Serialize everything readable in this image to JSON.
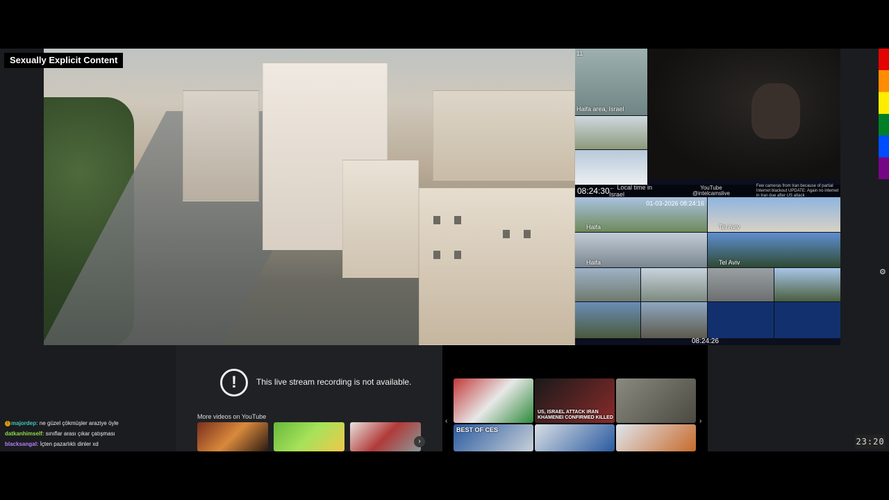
{
  "overlay": {
    "explicit_label": "Sexually Explicit Content"
  },
  "camera_grid": {
    "left_cam_a_number": "11",
    "left_cam_a_label": "Haifa area, Israel",
    "ticker_time": "08:24:30",
    "ticker_local": "← Local time in Israel",
    "ticker_source": "YouTube",
    "ticker_handle": "@intelcamslive",
    "ticker_news": "Few cameras from Iran because of partial Internet blackout UPDATE: Again no internet in Iran due after US attack",
    "tiles": [
      {
        "city": "Haifa",
        "timestamp": "01-03-2026 08:24:16"
      },
      {
        "city": "Tel Aviv",
        "timestamp": ""
      },
      {
        "city": "Haifa",
        "timestamp": ""
      },
      {
        "city": "Tel Aviv",
        "timestamp": ""
      }
    ],
    "bottom_clock": "08:24:26"
  },
  "youtube_embed": {
    "unavailable_message": "This live stream recording is not available.",
    "more_videos_label": "More videos on YouTube",
    "next_arrow": "›"
  },
  "news": {
    "headline_1": "US, ISRAEL ATTACK IRAN KHAMENEI CONFIRMED KILLED",
    "headline_2": "BEST OF CES",
    "prev_arrow": "‹",
    "next_arrow": "›"
  },
  "chat": {
    "messages": [
      {
        "user": "majordep:",
        "text": "ne güzel çökmüşler araziye öyle",
        "color": "#3fc8b8"
      },
      {
        "user": "datkanhimself:",
        "text": "sınıflar arası çıkar çatışması",
        "color": "#8fd94a"
      },
      {
        "user": "blacksangal:",
        "text": "İçten pazarlıklı dinler xd",
        "color": "#b57cff"
      }
    ]
  },
  "player": {
    "settings_icon": "gear-icon",
    "clock": "23:20"
  }
}
